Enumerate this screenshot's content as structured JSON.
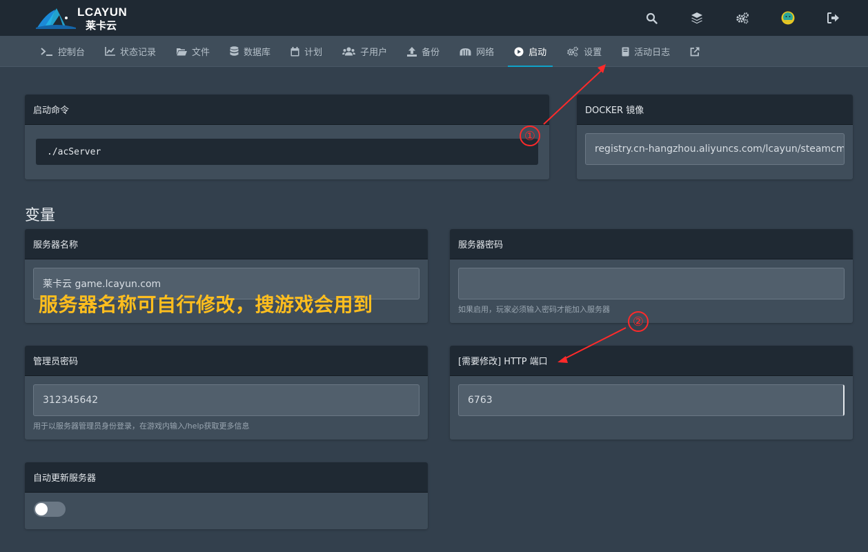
{
  "brand": {
    "name_en": "LCAYUN",
    "name_cn": "莱卡云"
  },
  "topbar": {
    "icons": [
      "search-icon",
      "layers-icon",
      "cogs-icon",
      "avatar-icon",
      "sign-out-icon"
    ]
  },
  "nav": {
    "items": [
      {
        "label": "控制台",
        "icon": "terminal-icon"
      },
      {
        "label": "状态记录",
        "icon": "chart-line-icon"
      },
      {
        "label": "文件",
        "icon": "folder-open-icon"
      },
      {
        "label": "数据库",
        "icon": "database-icon"
      },
      {
        "label": "计划",
        "icon": "calendar-icon"
      },
      {
        "label": "子用户",
        "icon": "users-icon"
      },
      {
        "label": "备份",
        "icon": "upload-icon"
      },
      {
        "label": "网络",
        "icon": "network-icon"
      },
      {
        "label": "启动",
        "icon": "play-circle-icon",
        "active": true
      },
      {
        "label": "设置",
        "icon": "cogs-icon"
      },
      {
        "label": "活动日志",
        "icon": "book-icon"
      }
    ],
    "external_icon": "external-link-icon"
  },
  "startup": {
    "title": "启动命令",
    "command": "./acServer"
  },
  "docker": {
    "title": "DOCKER 镜像",
    "image": "registry.cn-hangzhou.aliyuncs.com/lcayun/steamcmd"
  },
  "variables": {
    "title": "变量",
    "server_name": {
      "label": "服务器名称",
      "value": "莱卡云 game.lcayun.com"
    },
    "server_password": {
      "label": "服务器密码",
      "value": "",
      "help": "如果启用，玩家必须输入密码才能加入服务器"
    },
    "admin_password": {
      "label": "管理员密码",
      "value": "312345642",
      "help": "用于以服务器管理员身份登录，在游戏内输入/help获取更多信息"
    },
    "http_port": {
      "label": "[需要修改] HTTP 端口",
      "value": "6763"
    },
    "auto_update": {
      "label": "自动更新服务器",
      "enabled": false
    }
  },
  "annotations": {
    "note": "服务器名称可自行修改，搜游戏会用到",
    "marker1": "①",
    "marker2": "②",
    "color_text": "#ffbe1e",
    "color_marker": "#ff2a2a"
  },
  "colors": {
    "accent": "#0fa3c9",
    "background": "#33404d",
    "header": "#1f2933"
  }
}
